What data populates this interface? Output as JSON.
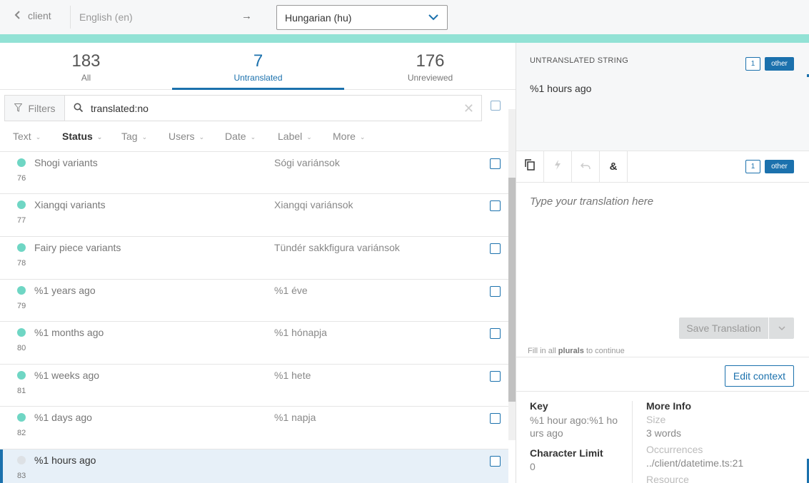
{
  "topbar": {
    "back_label": "client",
    "source_language": "English (en)",
    "arrow": "→",
    "target_language": "Hungarian (hu)"
  },
  "tabs": [
    {
      "count": "183",
      "label": "All"
    },
    {
      "count": "7",
      "label": "Untranslated",
      "active": true
    },
    {
      "count": "176",
      "label": "Unreviewed"
    }
  ],
  "filters": {
    "button_label": "Filters",
    "search_value": "translated:no"
  },
  "sort_columns": [
    {
      "label": "Text"
    },
    {
      "label": "Status",
      "active": true
    },
    {
      "label": "Tag"
    },
    {
      "label": "Users"
    },
    {
      "label": "Date"
    },
    {
      "label": "Label"
    },
    {
      "label": "More"
    }
  ],
  "rows": [
    {
      "source": "Shogi variants",
      "translation": "Sógi variánsok",
      "index": "76"
    },
    {
      "source": "Xiangqi variants",
      "translation": "Xiangqi variánsok",
      "index": "77"
    },
    {
      "source": "Fairy piece variants",
      "translation": "Tündér sakkfigura variánsok",
      "index": "78"
    },
    {
      "source": "%1 years ago",
      "translation": "%1 éve",
      "index": "79"
    },
    {
      "source": "%1 months ago",
      "translation": "%1 hónapja",
      "index": "80"
    },
    {
      "source": "%1 weeks ago",
      "translation": "%1 hete",
      "index": "81"
    },
    {
      "source": "%1 days ago",
      "translation": "%1 napja",
      "index": "82"
    },
    {
      "source": "%1 hours ago",
      "translation": "",
      "index": "83",
      "selected": true
    }
  ],
  "source_panel": {
    "heading": "UNTRANSLATED STRING",
    "plural_number": "1",
    "plural_form": "other",
    "text": "%1 hours ago"
  },
  "editor": {
    "plural_number": "1",
    "plural_form": "other",
    "placeholder": "Type your translation here",
    "save_label": "Save Translation",
    "hint_prefix": "Fill in all",
    "hint_bold": "plurals",
    "hint_suffix": "to continue",
    "edit_context_label": "Edit context"
  },
  "info": {
    "key_heading": "Key",
    "key_value": "%1 hour ago:%1 hours ago",
    "limit_heading": "Character Limit",
    "limit_value": "0",
    "more_heading": "More Info",
    "size_label": "Size",
    "size_value": "3 words",
    "occurrences_label": "Occurrences",
    "occurrences_value": "../client/datetime.ts:21",
    "resource_label": "Resource"
  },
  "colors": {
    "accent": "#1b71ad",
    "teal_bar": "#92e2d5",
    "status_dot_translated": "#6fd6c4",
    "status_dot_untranslated": "#dde1e5"
  }
}
